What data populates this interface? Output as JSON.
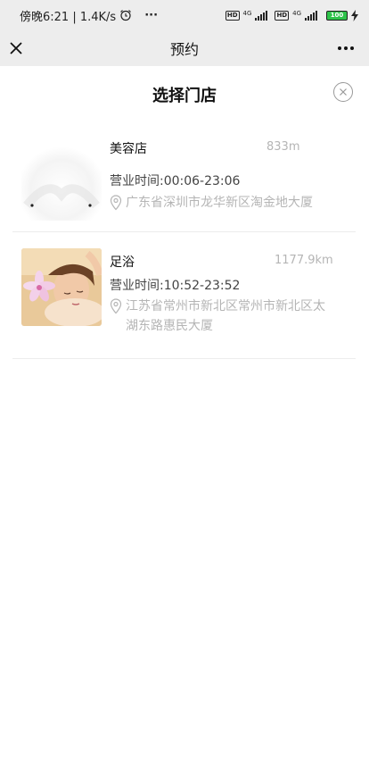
{
  "status_bar": {
    "time_speed": "傍晚6:21 | 1.4K/s",
    "alarm_icon": "alarm-clock-icon",
    "more_dots": "···",
    "hd1": "HD",
    "net1": "4G",
    "hd2": "HD",
    "net2": "4G",
    "battery": "100"
  },
  "nav": {
    "title": "预约",
    "close_icon": "close-icon",
    "more_icon": "more-icon"
  },
  "modal": {
    "title": "选择门店",
    "close_icon": "circle-close-icon"
  },
  "stores": [
    {
      "name": "美容店",
      "distance": "833m",
      "hours": "营业时间:00:06-23:06",
      "address": "广东省深圳市龙华新区淘金地大厦"
    },
    {
      "name": "足浴",
      "distance": "1177.9km",
      "hours": "营业时间:10:52-23:52",
      "address": "江苏省常州市新北区常州市新北区太湖东路惠民大厦"
    }
  ],
  "colors": {
    "bar_bg": "#ededed",
    "muted_text": "#b5b5b5",
    "battery_green": "#2ec34a"
  }
}
